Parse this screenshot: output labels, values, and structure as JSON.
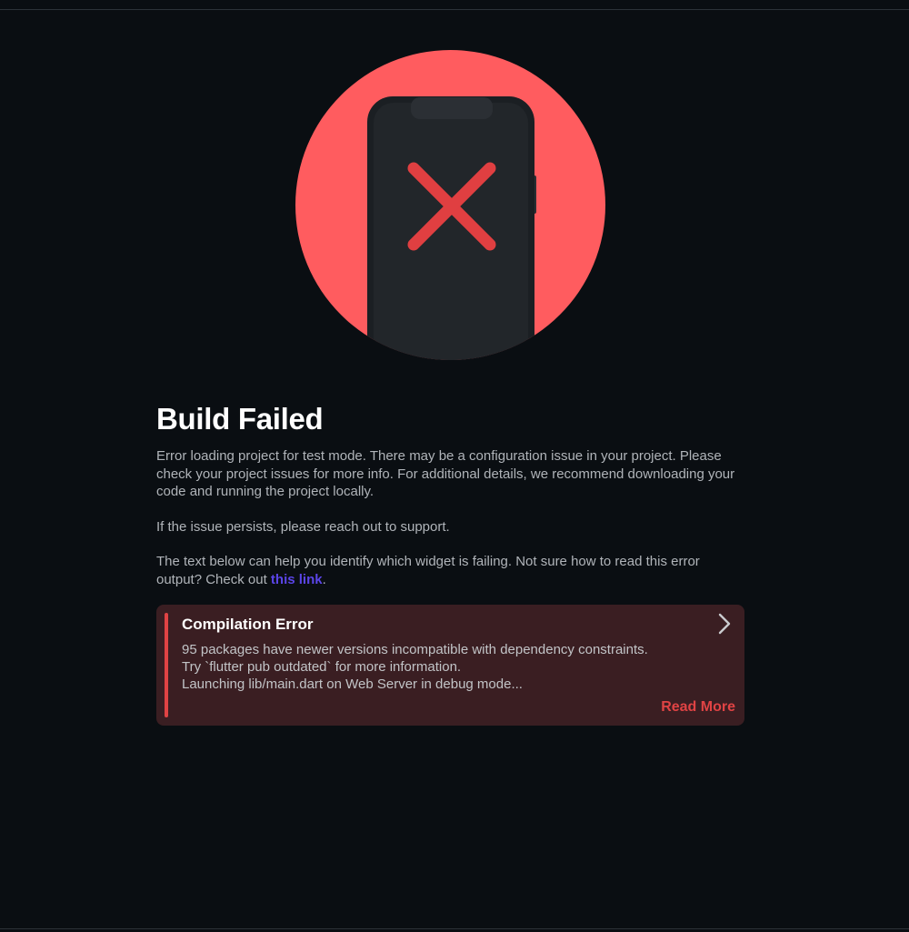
{
  "colors": {
    "background": "#0a0e12",
    "circle": "#ff5c5f",
    "phone": "#1f2327",
    "x_mark": "#e03f41",
    "link": "#5b45e8",
    "card_background": "#3a1e22",
    "accent": "#e04344"
  },
  "illustration": {
    "icon": "phone-with-x-icon"
  },
  "heading": {
    "title": "Build Failed"
  },
  "body": {
    "paragraph1": "Error loading project for test mode. There may be a configuration issue in your project. Please check your project issues for more info. For additional details, we recommend downloading your code and running the project locally.",
    "paragraph2": "If the issue persists, please reach out to support.",
    "paragraph3_prefix": "The text below can help you identify which widget is failing. Not sure how to read this error output? Check out ",
    "paragraph3_link": "this link",
    "paragraph3_suffix": "."
  },
  "error_card": {
    "title": "Compilation Error",
    "log_lines": [
      "95 packages have newer versions incompatible with dependency constraints.",
      "Try `flutter pub outdated` for more information.",
      "Launching lib/main.dart on Web Server in debug mode..."
    ],
    "read_more_label": "Read More",
    "chevron_icon": "chevron-right-icon"
  }
}
